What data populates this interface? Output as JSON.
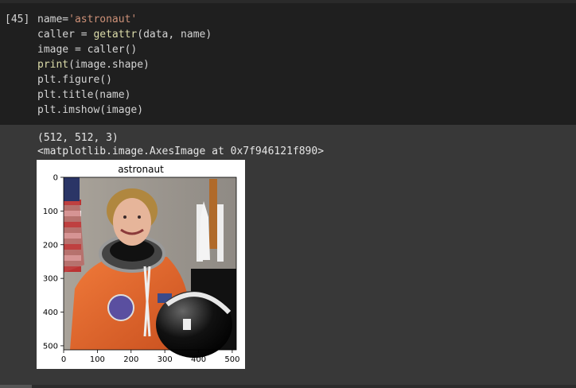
{
  "cell": {
    "prompt": "[45]",
    "code_lines": [
      [
        {
          "t": "name="
        },
        {
          "t": "'astronaut'",
          "c": "str"
        }
      ],
      [
        {
          "t": "caller = "
        },
        {
          "t": "getattr",
          "c": "fn"
        },
        {
          "t": "(data, name)"
        }
      ],
      [
        {
          "t": "image = caller()"
        }
      ],
      [
        {
          "t": "print",
          "c": "fn"
        },
        {
          "t": "(image.shape)"
        }
      ],
      [
        {
          "t": "plt.figure()"
        }
      ],
      [
        {
          "t": "plt.title(name)"
        }
      ],
      [
        {
          "t": "plt.imshow(image)"
        }
      ]
    ]
  },
  "output": {
    "shape_line": "(512, 512, 3)",
    "repr_line": "<matplotlib.image.AxesImage at 0x7f946121f890>"
  },
  "figure": {
    "title": "astronaut",
    "x_ticks": [
      "0",
      "100",
      "200",
      "300",
      "400",
      "500"
    ],
    "y_ticks": [
      "0",
      "100",
      "200",
      "300",
      "400",
      "500"
    ],
    "image_label": "astronaut image"
  },
  "colors": {
    "editor_bg": "#1f1f1f",
    "output_bg": "#383838",
    "string": "#ce9178",
    "function": "#dcdcaa"
  }
}
